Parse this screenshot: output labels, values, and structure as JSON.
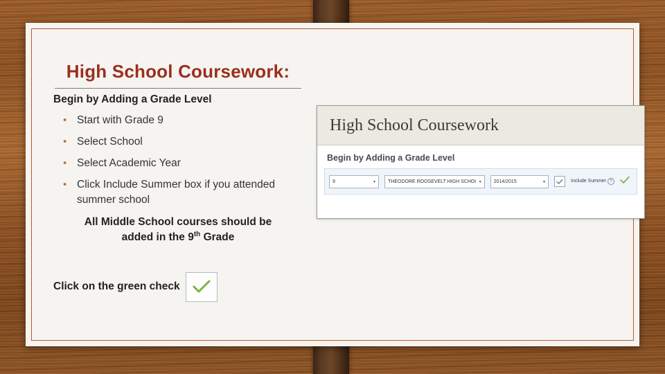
{
  "slide": {
    "title": "High School Coursework:",
    "subhead": "Begin by Adding a Grade Level",
    "bullets": [
      "Start with Grade 9",
      "Select School",
      "Select Academic Year",
      "Click Include Summer box if you attended summer school"
    ],
    "note_line1": "All Middle School courses should be",
    "note_line2_pre": "added in the 9",
    "note_line2_sup": "th",
    "note_line2_post": " Grade",
    "click_instruction": "Click on the green check",
    "accent_color": "#9b2f1f",
    "border_color": "#b35a2a",
    "bullet_color": "#b0793f",
    "check_color": "#6aa84f"
  },
  "screenshot": {
    "header_title": "High School Coursework",
    "section_label": "Begin by Adding a Grade Level",
    "grade_select": {
      "value": "9",
      "caret": "▾"
    },
    "school_select": {
      "value": "THEODORE ROOSEVELT HIGH SCHOOL",
      "caret": "▾"
    },
    "year_select": {
      "value": "2014/2015",
      "caret": "▾"
    },
    "include_summer": {
      "checked": true,
      "label": "Include Summer",
      "badge": "?"
    },
    "confirm_check": "✓"
  }
}
